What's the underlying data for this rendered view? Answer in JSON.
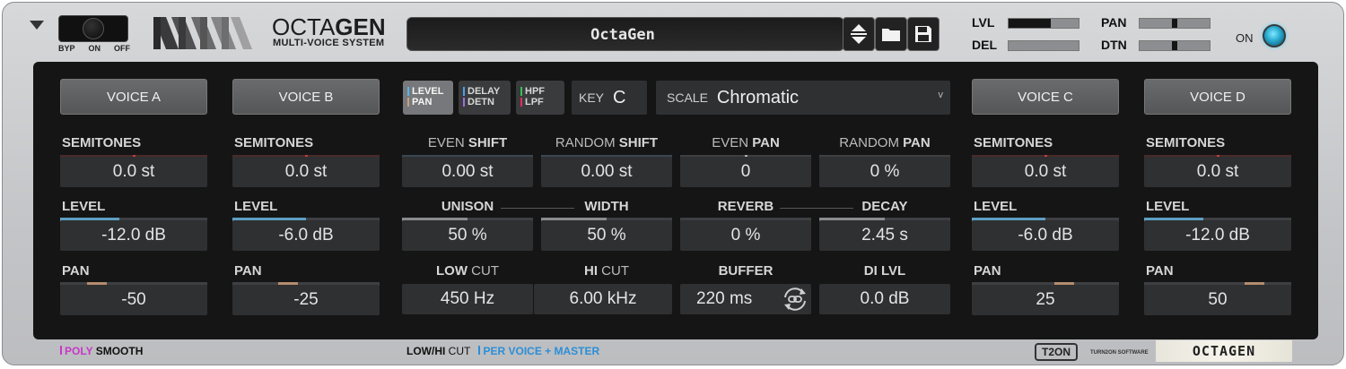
{
  "header": {
    "bypass": {
      "labels": [
        "BYP",
        "ON",
        "OFF"
      ]
    },
    "logo": {
      "title_light": "OCTA",
      "title_bold": "GEN",
      "subtitle": "MULTI-VOICE SYSTEM"
    },
    "preset": {
      "name": "OctaGen"
    },
    "meters": {
      "lvl": {
        "label": "LVL",
        "fraction": 0.6
      },
      "del": {
        "label": "DEL",
        "fraction": 0.0
      },
      "pan": {
        "label": "PAN",
        "position": 0.5
      },
      "dtn": {
        "label": "DTN",
        "position": 0.5
      }
    },
    "power": {
      "label": "ON"
    }
  },
  "voices": [
    {
      "button": "VOICE A",
      "semitones_label": "SEMITONES",
      "semitones": "0.0 st",
      "semitones_pos": 0.5,
      "level_label": "LEVEL",
      "level": "-12.0 dB",
      "level_fraction": 0.4,
      "pan_label": "PAN",
      "pan": "-50",
      "pan_pos": 0.25
    },
    {
      "button": "VOICE B",
      "semitones_label": "SEMITONES",
      "semitones": "0.0 st",
      "semitones_pos": 0.5,
      "level_label": "LEVEL",
      "level": "-6.0 dB",
      "level_fraction": 0.5,
      "pan_label": "PAN",
      "pan": "-25",
      "pan_pos": 0.375
    },
    {
      "button": "VOICE C",
      "semitones_label": "SEMITONES",
      "semitones": "0.0 st",
      "semitones_pos": 0.5,
      "level_label": "LEVEL",
      "level": "-6.0 dB",
      "level_fraction": 0.5,
      "pan_label": "PAN",
      "pan": "25",
      "pan_pos": 0.625
    },
    {
      "button": "VOICE D",
      "semitones_label": "SEMITONES",
      "semitones": "0.0 st",
      "semitones_pos": 0.5,
      "level_label": "LEVEL",
      "level": "-12.0 dB",
      "level_fraction": 0.4,
      "pan_label": "PAN",
      "pan": "50",
      "pan_pos": 0.75
    }
  ],
  "view_tabs": {
    "level_pan": {
      "line1": "LEVEL",
      "line2": "PAN"
    },
    "delay_detn": {
      "line1": "DELAY",
      "line2": "DETN"
    },
    "hpf_lpf": {
      "line1": "HPF",
      "line2": "LPF"
    }
  },
  "key": {
    "label": "KEY",
    "value": "C"
  },
  "scale": {
    "label": "SCALE",
    "value": "Chromatic",
    "arrow": "v"
  },
  "center": {
    "even_shift": {
      "light": "EVEN",
      "bold": "SHIFT",
      "value": "0.00 st"
    },
    "random_shift": {
      "light": "RANDOM",
      "bold": "SHIFT",
      "value": "0.00 st"
    },
    "even_pan": {
      "light": "EVEN",
      "bold": "PAN",
      "value": "0",
      "pos": 0.5
    },
    "random_pan": {
      "light": "RANDOM",
      "bold": "PAN",
      "value": "0 %"
    },
    "unison": {
      "label": "UNISON",
      "value": "50 %",
      "fraction": 0.5
    },
    "width": {
      "label": "WIDTH",
      "value": "50 %",
      "fraction": 0.5
    },
    "reverb": {
      "label": "REVERB",
      "value": "0 %",
      "fraction": 0.0
    },
    "decay": {
      "label": "DECAY",
      "value": "2.45 s",
      "fraction": 0.5
    },
    "low_cut": {
      "bold": "LOW",
      "light": "CUT",
      "value": "450 Hz"
    },
    "hi_cut": {
      "bold": "HI",
      "light": "CUT",
      "value": "6.00 kHz"
    },
    "buffer": {
      "label": "BUFFER",
      "value": "220 ms"
    },
    "di_lvl": {
      "label": "DI LVL",
      "value": "0.0 dB"
    }
  },
  "footer": {
    "poly": "POLY",
    "smooth": "SMOOTH",
    "lowhi_bold": "LOW/HI",
    "lowhi_light": "CUT",
    "per_voice": "PER VOICE + MASTER",
    "t2on": "T2ON",
    "software": "TURN2ON SOFTWARE",
    "signature": "OCTAGEN"
  },
  "colors": {
    "level_blue": "#5e9fc4",
    "pan_tan": "#b48c6e",
    "semitone_red": "#c43c3c",
    "shift_blue": "#4c6b88",
    "poly_magenta": "#c737c9",
    "per_voice_blue": "#2a8fd8",
    "hpf_green": "#36c25a",
    "lpf_red": "#e0305a",
    "delay_blue": "#4da0e6",
    "detn_purple": "#a06ee0",
    "level_tab_blue": "#56b6ea",
    "pan_tab_tan": "#c6a07e"
  },
  "icons": [
    "menu-arrow-icon",
    "up-down-arrows-icon",
    "folder-icon",
    "save-icon",
    "link-icon",
    "power-icon"
  ]
}
